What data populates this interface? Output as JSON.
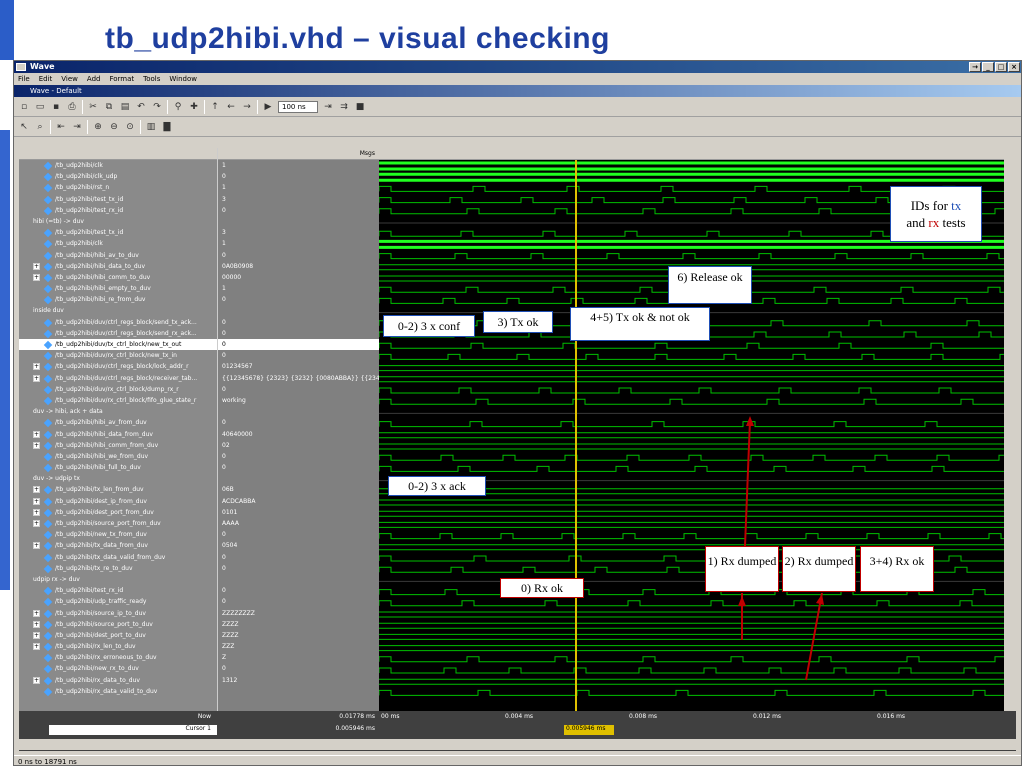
{
  "slide": {
    "title": "tb_udp2hibi.vhd – visual checking"
  },
  "window": {
    "title": "Wave",
    "subtitle": "Wave - Default"
  },
  "menu": [
    "File",
    "Edit",
    "View",
    "Add",
    "Format",
    "Tools",
    "Window"
  ],
  "toolbar": {
    "time_value": "100 ns"
  },
  "headers": {
    "msgs": "Msgs"
  },
  "signals": [
    {
      "name": "/tb_udp2hibi/clk",
      "value": "1",
      "kind": "sig"
    },
    {
      "name": "/tb_udp2hibi/clk_udp",
      "value": "0",
      "kind": "sig"
    },
    {
      "name": "/tb_udp2hibi/rst_n",
      "value": "1",
      "kind": "sig"
    },
    {
      "name": "/tb_udp2hibi/test_tx_id",
      "value": "3",
      "kind": "sig"
    },
    {
      "name": "/tb_udp2hibi/test_rx_id",
      "value": "0",
      "kind": "sig"
    },
    {
      "name": "hibi (=tb) -> duv",
      "value": "",
      "kind": "div"
    },
    {
      "name": "/tb_udp2hibi/test_tx_id",
      "value": "3",
      "kind": "sig"
    },
    {
      "name": "/tb_udp2hibi/clk",
      "value": "1",
      "kind": "sig"
    },
    {
      "name": "/tb_udp2hibi/hibi_av_to_duv",
      "value": "0",
      "kind": "sig"
    },
    {
      "name": "/tb_udp2hibi/hibi_data_to_duv",
      "value": "0A0B0908",
      "kind": "bus"
    },
    {
      "name": "/tb_udp2hibi/hibi_comm_to_duv",
      "value": "00000",
      "kind": "bus"
    },
    {
      "name": "/tb_udp2hibi/hibi_empty_to_duv",
      "value": "1",
      "kind": "sig"
    },
    {
      "name": "/tb_udp2hibi/hibi_re_from_duv",
      "value": "0",
      "kind": "sig"
    },
    {
      "name": "inside duv",
      "value": "",
      "kind": "div"
    },
    {
      "name": "/tb_udp2hibi/duv/ctrl_regs_block/send_tx_ack...",
      "value": "0",
      "kind": "sig"
    },
    {
      "name": "/tb_udp2hibi/duv/ctrl_regs_block/send_rx_ack...",
      "value": "0",
      "kind": "sig"
    },
    {
      "name": "/tb_udp2hibi/duv/tx_ctrl_block/new_tx_out",
      "value": "0",
      "kind": "sel"
    },
    {
      "name": "/tb_udp2hibi/duv/rx_ctrl_block/new_tx_in",
      "value": "0",
      "kind": "sig"
    },
    {
      "name": "/tb_udp2hibi/duv/ctrl_regs_block/lock_addr_r",
      "value": "01234567",
      "kind": "bus"
    },
    {
      "name": "/tb_udp2hibi/duv/ctrl_regs_block/receiver_tab...",
      "value": "{{12345678} {2323} {3232} {0080ABBA}} {{2345",
      "kind": "bus"
    },
    {
      "name": "/tb_udp2hibi/duv/rx_ctrl_block/dump_rx_r",
      "value": "0",
      "kind": "sig"
    },
    {
      "name": "/tb_udp2hibi/duv/rx_ctrl_block/fifo_glue_state_r",
      "value": "working",
      "kind": "sig"
    },
    {
      "name": "duv -> hibi, ack + data",
      "value": "",
      "kind": "div"
    },
    {
      "name": "/tb_udp2hibi/hibi_av_from_duv",
      "value": "0",
      "kind": "sig"
    },
    {
      "name": "/tb_udp2hibi/hibi_data_from_duv",
      "value": "40640000",
      "kind": "bus"
    },
    {
      "name": "/tb_udp2hibi/hibi_comm_from_duv",
      "value": "02",
      "kind": "bus"
    },
    {
      "name": "/tb_udp2hibi/hibi_we_from_duv",
      "value": "0",
      "kind": "sig"
    },
    {
      "name": "/tb_udp2hibi/hibi_full_to_duv",
      "value": "0",
      "kind": "sig"
    },
    {
      "name": "duv -> udpip tx",
      "value": "",
      "kind": "div"
    },
    {
      "name": "/tb_udp2hibi/tx_len_from_duv",
      "value": "06B",
      "kind": "bus"
    },
    {
      "name": "/tb_udp2hibi/dest_ip_from_duv",
      "value": "ACDCABBA",
      "kind": "bus"
    },
    {
      "name": "/tb_udp2hibi/dest_port_from_duv",
      "value": "0101",
      "kind": "bus"
    },
    {
      "name": "/tb_udp2hibi/source_port_from_duv",
      "value": "AAAA",
      "kind": "bus"
    },
    {
      "name": "/tb_udp2hibi/new_tx_from_duv",
      "value": "0",
      "kind": "sig"
    },
    {
      "name": "/tb_udp2hibi/tx_data_from_duv",
      "value": "0504",
      "kind": "bus"
    },
    {
      "name": "/tb_udp2hibi/tx_data_valid_from_duv",
      "value": "0",
      "kind": "sig"
    },
    {
      "name": "/tb_udp2hibi/tx_re_to_duv",
      "value": "0",
      "kind": "sig"
    },
    {
      "name": "udpip rx -> duv",
      "value": "",
      "kind": "div"
    },
    {
      "name": "/tb_udp2hibi/test_rx_id",
      "value": "0",
      "kind": "sig"
    },
    {
      "name": "/tb_udp2hibi/udp_traffic_ready",
      "value": "0",
      "kind": "sig"
    },
    {
      "name": "/tb_udp2hibi/source_ip_to_duv",
      "value": "ZZZZZZZZ",
      "kind": "bus"
    },
    {
      "name": "/tb_udp2hibi/source_port_to_duv",
      "value": "ZZZZ",
      "kind": "bus"
    },
    {
      "name": "/tb_udp2hibi/dest_port_to_duv",
      "value": "ZZZZ",
      "kind": "bus"
    },
    {
      "name": "/tb_udp2hibi/rx_len_to_duv",
      "value": "ZZZ",
      "kind": "bus"
    },
    {
      "name": "/tb_udp2hibi/rx_erroneous_to_duv",
      "value": "Z",
      "kind": "sig"
    },
    {
      "name": "/tb_udp2hibi/new_rx_to_duv",
      "value": "0",
      "kind": "sig"
    },
    {
      "name": "/tb_udp2hibi/rx_data_to_duv",
      "value": "1312",
      "kind": "bus"
    },
    {
      "name": "/tb_udp2hibi/rx_data_valid_to_duv",
      "value": "",
      "kind": "sig"
    }
  ],
  "bottom": {
    "now_label": "Now",
    "now_value": "0.01778 ms",
    "cursor_label": "Cursor 1",
    "cursor_value": "0.005946 ms",
    "cursor_time": "0.005946 ms",
    "ticks": [
      "00 ms",
      "0.004 ms",
      "0.008 ms",
      "0.012 ms",
      "0.016 ms"
    ]
  },
  "status": "0 ns to 18791 ns",
  "annotations": {
    "ids": [
      "IDs for ",
      "tx",
      "and ",
      "rx",
      " tests"
    ],
    "release": "6) Release ok",
    "conf": "0-2) 3 x conf",
    "txok": "3) Tx ok",
    "txnot": "4+5) Tx ok & not ok",
    "ack": "0-2) 3 x ack",
    "rxok": "0) Rx ok",
    "rx1": "1) Rx dumped",
    "rx2": "2) Rx dumped",
    "rx34": "3+4) Rx ok"
  },
  "colors": {
    "title": "#1f3f9f",
    "trace": "#00e000",
    "cursor": "#e0c000",
    "annotation_red": "#c00000"
  }
}
